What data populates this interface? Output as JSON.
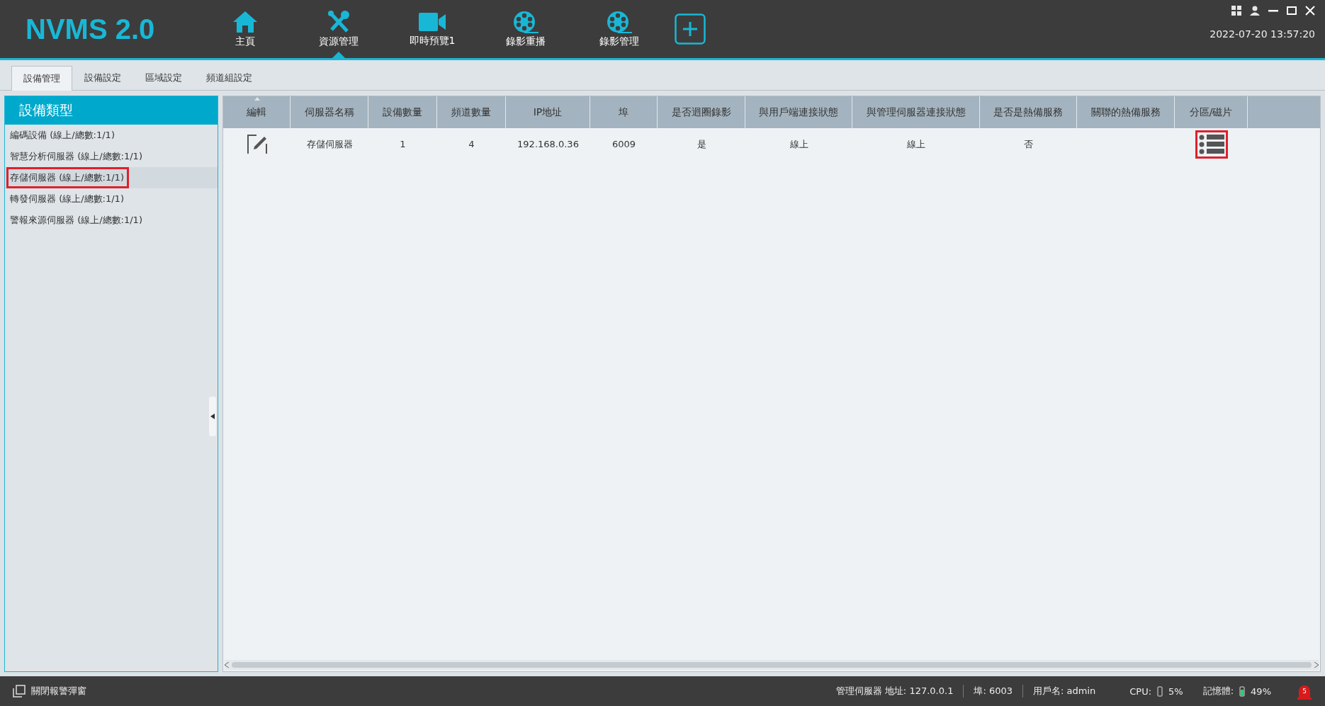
{
  "app": {
    "logo": "NVMS 2.0",
    "datetime": "2022-07-20 13:57:20"
  },
  "nav": [
    {
      "label": "主頁",
      "kind": "home",
      "selected": false
    },
    {
      "label": "資源管理",
      "kind": "tools",
      "selected": true
    },
    {
      "label": "即時預覽1",
      "kind": "camera",
      "selected": false
    },
    {
      "label": "錄影重播",
      "kind": "reel",
      "selected": false
    },
    {
      "label": "錄影管理",
      "kind": "reel",
      "selected": false
    }
  ],
  "tabs": [
    {
      "label": "設備管理",
      "selected": true
    },
    {
      "label": "設備設定",
      "selected": false
    },
    {
      "label": "區域設定",
      "selected": false
    },
    {
      "label": "頻道組設定",
      "selected": false
    }
  ],
  "sidebar": {
    "title": "設備類型",
    "items": [
      {
        "label": "編碼設備 (線上/總數:1/1)",
        "selected": false,
        "highlighted": false
      },
      {
        "label": "智慧分析伺服器 (線上/總數:1/1)",
        "selected": false,
        "highlighted": false
      },
      {
        "label": "存儲伺服器 (線上/總數:1/1)",
        "selected": true,
        "highlighted": true
      },
      {
        "label": "轉發伺服器 (線上/總數:1/1)",
        "selected": false,
        "highlighted": false
      },
      {
        "label": "警報來源伺服器 (線上/總數:1/1)",
        "selected": false,
        "highlighted": false
      }
    ]
  },
  "table": {
    "columns": [
      "編輯",
      "伺服器名稱",
      "設備數量",
      "頻道數量",
      "IP地址",
      "埠",
      "是否迴圈錄影",
      "與用戶端連接狀態",
      "與管理伺服器連接狀態",
      "是否是熱備服務",
      "關聯的熱備服務",
      "分區/磁片"
    ],
    "rows": [
      {
        "cells": [
          "",
          "存儲伺服器",
          "1",
          "4",
          "192.168.0.36",
          "6009",
          "是",
          "線上",
          "線上",
          "否",
          "",
          ""
        ],
        "partition_highlighted": true
      }
    ]
  },
  "status_bar": {
    "alarm_toggle": "關閉報警彈窗",
    "server": "管理伺服器 地址: 127.0.0.1",
    "port": "埠: 6003",
    "user": "用戶名: admin",
    "cpu_label": "CPU:",
    "cpu_value": "5%",
    "mem_label": "記憶體:",
    "mem_value": "49%",
    "alarm_count": "5"
  }
}
